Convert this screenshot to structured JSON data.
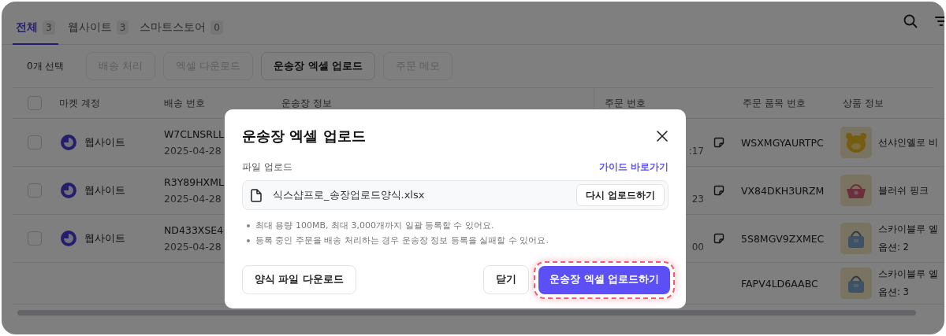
{
  "tabs": [
    {
      "label": "전체",
      "count": "3",
      "selected": true
    },
    {
      "label": "웹사이트",
      "count": "3",
      "selected": false
    },
    {
      "label": "스마트스토어",
      "count": "0",
      "selected": false
    }
  ],
  "toolbar": {
    "selection": "0개 선택",
    "buttons": [
      {
        "label": "배송 처리",
        "disabled": true
      },
      {
        "label": "엑셀 다운로드",
        "disabled": true
      },
      {
        "label": "운송장 엑셀 업로드",
        "disabled": false
      },
      {
        "label": "주문 메모",
        "disabled": true
      }
    ]
  },
  "table": {
    "header_checked": false,
    "columns": [
      "마켓 계정",
      "배송 번호",
      "운송장 정보",
      "주문 번호",
      "주문 품목 번호",
      "상품 정보"
    ],
    "rows": [
      {
        "kind": "shipment",
        "checked": false,
        "market": "웹사이트",
        "shipping_no": "W7CLNSRLL",
        "shipping_date": "2025-04-28",
        "order_time": ":17",
        "order_item_no": "WSXMGYAURTPC",
        "product_name": "선샤인옐로 비"
      },
      {
        "kind": "shipment",
        "checked": false,
        "market": "웹사이트",
        "shipping_no": "R3Y89HXML",
        "shipping_date": "2025-04-28",
        "order_time": "23",
        "order_item_no": "VX84DKH3URZM",
        "product_name": "블러쉬 핑크"
      },
      {
        "kind": "shipment",
        "checked": false,
        "market": "웹사이트",
        "shipping_no": "ND433XSE4",
        "shipping_date": "2025-04-28",
        "order_time": "00",
        "order_item_no": "5S8MGV9ZXMEC",
        "product_name": "스카이블루 엘",
        "product_option": "옵션: 2"
      },
      {
        "kind": "item",
        "order_item_no": "FAPV4LD6AABC",
        "product_name": "스카이블루 엘",
        "product_option": "옵션: 3"
      }
    ]
  },
  "modal": {
    "title": "운송장 엑셀 업로드",
    "file_label": "파일 업로드",
    "guide_link": "가이드 바로가기",
    "file_name": "식스샵프로_송장업로드양식.xlsx",
    "reupload_button": "다시 업로드하기",
    "notes": [
      "최대 용량 100MB, 최대 3,000개까지 일괄 등록할 수 있어요.",
      "등록 중인 주문을 배송 처리하는 경우 운송장 정보 등록을 실패할 수 있어요."
    ],
    "template_button": "양식 파일 다운로드",
    "close_button": "닫기",
    "submit_button": "운송장 엑셀 업로드하기",
    "submit_highlighted": true
  }
}
